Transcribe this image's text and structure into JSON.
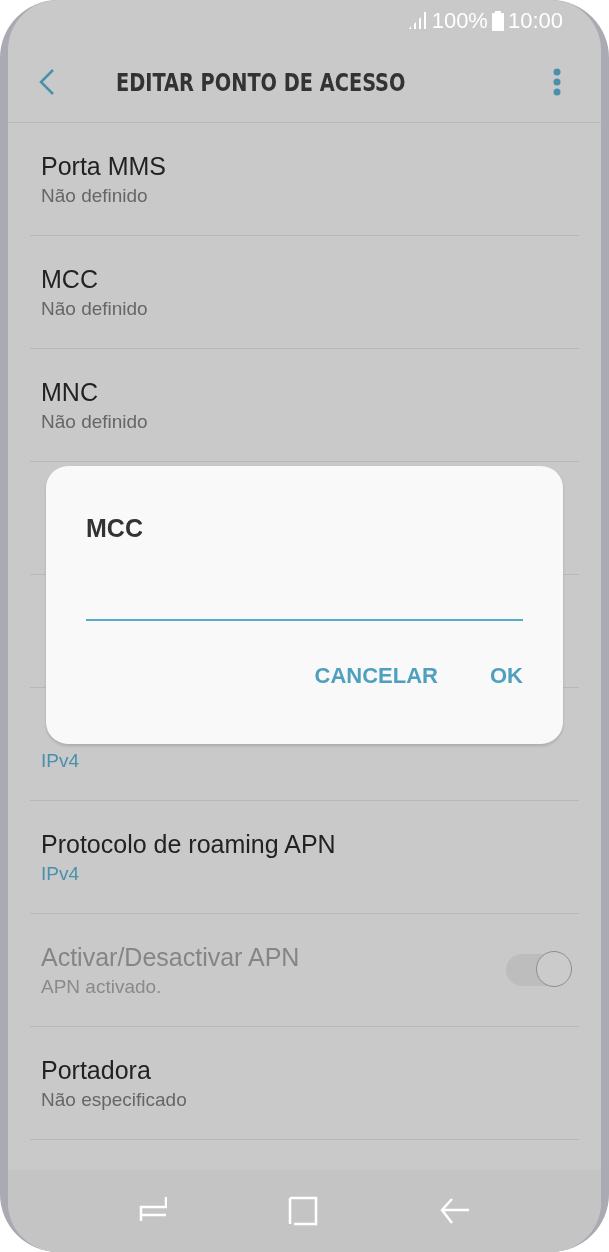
{
  "status_bar": {
    "battery": "100%",
    "time": "10:00"
  },
  "header": {
    "title": "EDITAR PONTO DE ACESSO"
  },
  "settings": [
    {
      "kind": "text",
      "title": "Porta MMS",
      "subtitle": "Não definido",
      "disabled": false
    },
    {
      "kind": "text",
      "title": "MCC",
      "subtitle": "Não definido",
      "disabled": false
    },
    {
      "kind": "text",
      "title": "MNC",
      "subtitle": "Não definido",
      "disabled": false
    },
    {
      "kind": "hidden"
    },
    {
      "kind": "hidden"
    },
    {
      "kind": "choice",
      "subtitle": "IPv4",
      "disabled": false
    },
    {
      "kind": "choice",
      "title": "Protocolo de roaming APN",
      "subtitle": "IPv4",
      "disabled": false
    },
    {
      "kind": "switch",
      "title": "Activar/Desactivar APN",
      "subtitle": "APN activado.",
      "disabled": true,
      "on": true
    },
    {
      "kind": "text",
      "title": "Portadora",
      "subtitle": "Não especificado",
      "disabled": false
    }
  ],
  "dialog": {
    "title": "MCC",
    "buttons": [
      "CANCELAR",
      "OK"
    ]
  }
}
